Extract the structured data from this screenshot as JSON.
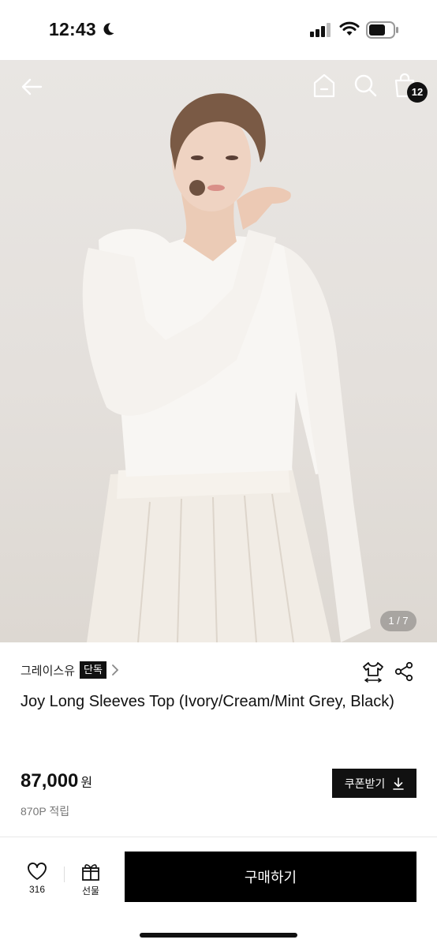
{
  "status_bar": {
    "time": "12:43",
    "icons": [
      "moon-icon",
      "signal-icon",
      "wifi-icon",
      "battery-icon"
    ]
  },
  "top_nav": {
    "icons": [
      "back-arrow-icon",
      "home-icon",
      "search-icon",
      "shopping-bag-icon"
    ],
    "cart_count": "12"
  },
  "gallery": {
    "counter": "1 / 7"
  },
  "product": {
    "brand": "그레이스유",
    "badge": "단독",
    "title": "Joy Long Sleeves Top (Ivory/Cream/Mint Grey, Black)",
    "price": "87,000",
    "currency": "원",
    "points": "870P 적립",
    "coupon_label": "쿠폰받기",
    "icons": [
      "chevron-right-icon",
      "size-guide-icon",
      "share-icon",
      "download-icon"
    ]
  },
  "bottom_bar": {
    "like_count": "316",
    "gift_label": "선물",
    "buy_label": "구매하기",
    "icons": [
      "heart-icon",
      "gift-icon"
    ]
  },
  "colors": {
    "primary": "#000000",
    "text": "#111111",
    "muted": "#777777",
    "background": "#ffffff"
  }
}
